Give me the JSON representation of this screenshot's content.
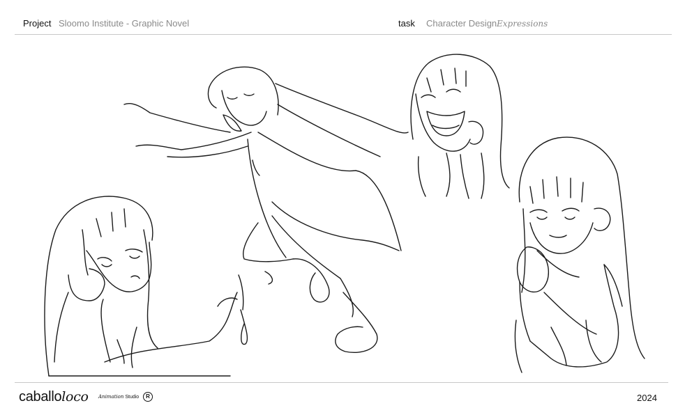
{
  "header": {
    "project_label": "Project",
    "project_value": "Sloomo Institute - Graphic Novel",
    "task_label": "task",
    "task_value": "Character Design",
    "task_note": "Expressions"
  },
  "footer": {
    "logo_regular": "caballo",
    "logo_italic": "loco",
    "studio_italic": "Animation",
    "studio_regular": "Studio",
    "registered_mark": "R",
    "year": "2024"
  },
  "sketches": [
    "character-sad-leaning-on-hand",
    "character-laughing-running-with-coat",
    "character-laughing-closed-eyes",
    "character-smiling-holding-pendant"
  ],
  "colors": {
    "line": "#1a1a1a",
    "muted_text": "#8a8a8a",
    "rule": "#c8c8c8"
  }
}
